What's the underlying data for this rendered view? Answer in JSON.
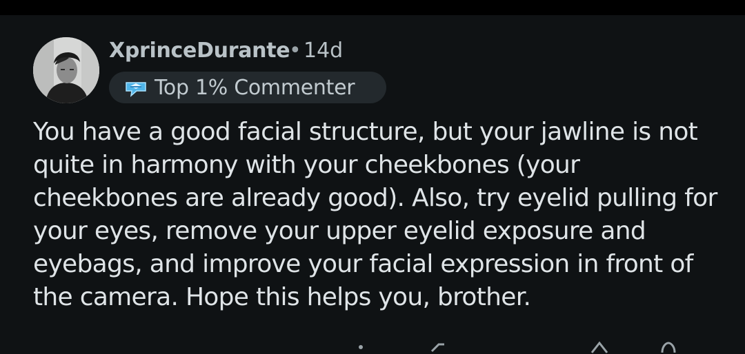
{
  "comment": {
    "author": {
      "username": "XprinceDurante",
      "separator": "•",
      "age": "14d",
      "flair": "Top 1% Commenter",
      "flair_icon": "top-commenter-badge-icon",
      "avatar_icon": "user-avatar-photo"
    },
    "body": "You have a good facial structure, but your jawline is not quite in harmony with your cheekbones (your cheekbones are already good). Also, try eyelid pulling for your eyes, remove your upper eyelid exposure and eyebags, and improve your facial expression in front of the camera. Hope this helps you, brother.",
    "actions": {
      "icons": [
        "more-options-icon",
        "share-icon",
        "upvote-icon",
        "reply-icon"
      ]
    }
  },
  "colors": {
    "background": "#0f1214",
    "status_bar": "#000000",
    "username": "#b9c2c7",
    "body_text": "#dfe4e7",
    "flair_background": "#23292d",
    "badge_accent": "#4fb4e8"
  }
}
